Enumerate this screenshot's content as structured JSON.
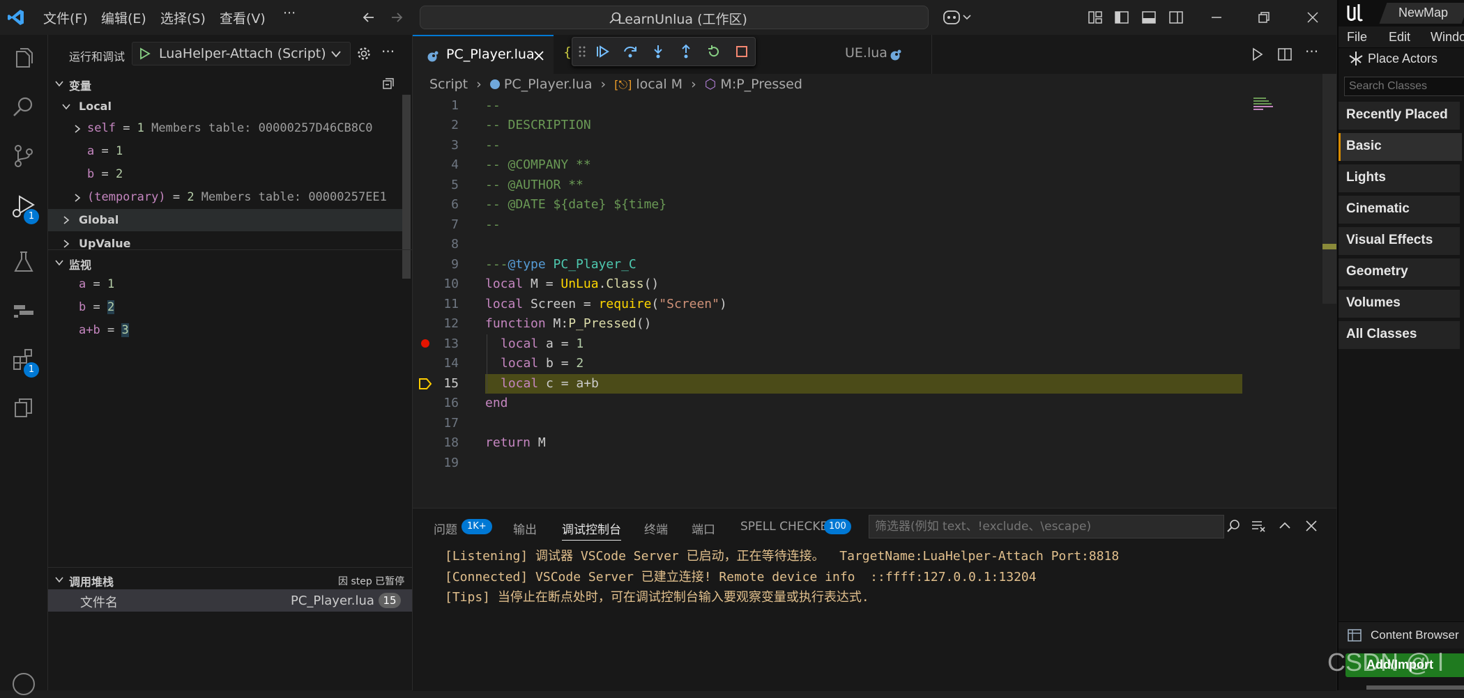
{
  "titlebar": {
    "menus": [
      "文件(F)",
      "编辑(E)",
      "选择(S)",
      "查看(V)",
      "···"
    ],
    "search_text": "LearnUnlua (工作区)"
  },
  "activity": {
    "debug_badge": "1",
    "extensions_badge": "1"
  },
  "sidebar": {
    "run_debug_label": "运行和调试",
    "config_name": "LuaHelper-Attach (Script)",
    "variables_title": "变量",
    "local_title": "Local",
    "vars": [
      {
        "name": "self",
        "op": " = ",
        "value": "1",
        "rest": " Members table: 00000257D46CB8C0"
      },
      {
        "name": "a",
        "op": " = ",
        "value": "1",
        "rest": ""
      },
      {
        "name": "b",
        "op": " = ",
        "value": "2",
        "rest": ""
      },
      {
        "name": "(temporary)",
        "op": " = ",
        "value": "2",
        "rest": " Members table: 00000257EE1…"
      }
    ],
    "global_title": "Global",
    "upvalue_title": "UpValue",
    "watch_title": "监视",
    "watch": [
      {
        "expr": "a",
        "op": " = ",
        "value": "1"
      },
      {
        "expr": "b",
        "op": " = ",
        "value": "2"
      },
      {
        "expr": "a+b",
        "op": " = ",
        "value": "3"
      }
    ],
    "callstack_title": "调用堆栈",
    "callstack_status": "因 step 已暂停",
    "frame_name": "文件名",
    "frame_file": "PC_Player.lua",
    "frame_line": "15"
  },
  "editor": {
    "tabs": [
      {
        "label": "PC_Player.lua",
        "active": true
      },
      {
        "label": "UE.lua",
        "active": false
      }
    ],
    "breadcrumb": [
      "Script",
      "PC_Player.lua",
      "local M",
      "M:P_Pressed"
    ],
    "line_numbers": [
      "1",
      "2",
      "3",
      "4",
      "5",
      "6",
      "7",
      "8",
      "9",
      "10",
      "11",
      "12",
      "13",
      "14",
      "15",
      "16",
      "17",
      "18",
      "19"
    ],
    "lines": {
      "l1": "--",
      "l2": "-- DESCRIPTION",
      "l3": "--",
      "l4": "-- @COMPANY **",
      "l5": "-- @AUTHOR **",
      "l6": "-- @DATE ${date} ${time}",
      "l7": "--",
      "l9a": "---",
      "l9b": "@type",
      "l9c": " PC_Player_C",
      "l10a": "local",
      "l10b": " M = ",
      "l10c": "UnLua",
      "l10d": ".",
      "l10e": "Class",
      "l10f": "()",
      "l11a": "local",
      "l11b": " Screen = ",
      "l11c": "require",
      "l11d": "(",
      "l11e": "\"Screen\"",
      "l11f": ")",
      "l12a": "function",
      "l12b": " M:",
      "l12c": "P_Pressed",
      "l12d": "()",
      "l13a": "local",
      "l13b": " a = ",
      "l13c": "1",
      "l14a": "local",
      "l14b": " b = ",
      "l14c": "2",
      "l15a": "local",
      "l15b": " c = a+b",
      "l16": "end",
      "l18a": "return",
      "l18b": " M"
    }
  },
  "panel": {
    "tabs": [
      "问题",
      "输出",
      "调试控制台",
      "终端",
      "端口",
      "SPELL CHECKER"
    ],
    "problems_badge": "1K+",
    "spell_badge": "100",
    "filter_placeholder": "筛选器(例如 text、!exclude、\\escape)",
    "console": [
      "[Listening] 调试器 VSCode Server 已启动，正在等待连接。  TargetName:LuaHelper-Attach Port:8818",
      "[Connected] VSCode Server 已建立连接! Remote device info  ::ffff:127.0.0.1:13204",
      "[Tips] 当停止在断点处时，可在调试控制台输入要观察变量或执行表达式."
    ]
  },
  "unreal": {
    "map_name": "NewMap",
    "menu": [
      "File",
      "Edit",
      "Windo"
    ],
    "place_actors": "Place Actors",
    "search_placeholder": "Search Classes",
    "categories": [
      "Recently Placed",
      "Basic",
      "Lights",
      "Cinematic",
      "Visual Effects",
      "Geometry",
      "Volumes",
      "All Classes"
    ],
    "content_browser": "Content Browser",
    "add_import": "Add/Import",
    "watermark": "CSDN @ l"
  },
  "colors": {
    "accent": "#0078d4",
    "current_line": "#4b4b18",
    "breakpoint": "#e51400",
    "console_text": "#e2c08d"
  }
}
